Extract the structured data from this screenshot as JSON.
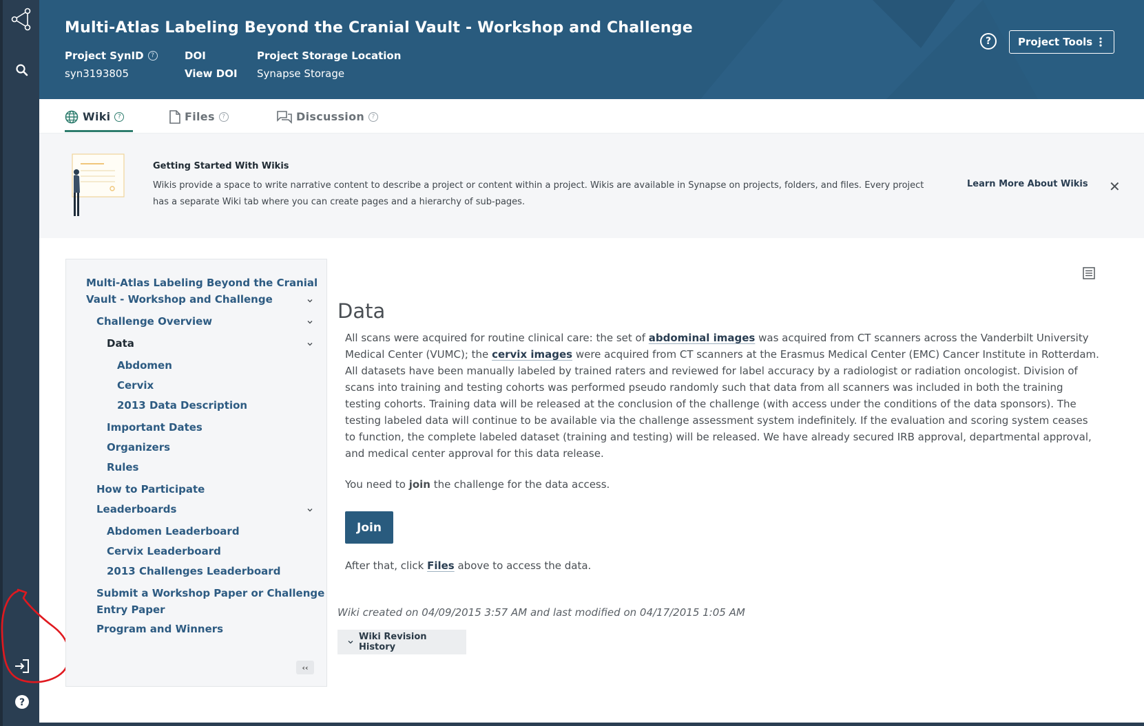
{
  "header": {
    "title": "Multi-Atlas Labeling Beyond the Cranial Vault - Workshop and Challenge",
    "synid_label": "Project SynID",
    "synid_value": "syn3193805",
    "doi_label": "DOI",
    "doi_value": "View DOI",
    "storage_label": "Project Storage Location",
    "storage_value": "Synapse Storage",
    "tools_label": "Project Tools",
    "help_glyph": "?"
  },
  "tabs": [
    {
      "label": "Wiki",
      "icon": "globe-icon"
    },
    {
      "label": "Files",
      "icon": "file-icon"
    },
    {
      "label": "Discussion",
      "icon": "discussion-icon"
    }
  ],
  "banner": {
    "title": "Getting Started With Wikis",
    "text": "Wikis provide a space to write narrative content to describe a project or content within a project. Wikis are available in Synapse on projects, folders, and files. Every project has a separate Wiki tab where you can create pages and a hierarchy of sub-pages.",
    "link": "Learn More About Wikis"
  },
  "nav": {
    "root_line1": "Multi-Atlas Labeling Beyond the Cranial",
    "root_line2": "Vault - Workshop and Challenge",
    "challenge_overview": "Challenge Overview",
    "data": "Data",
    "abdomen": "Abdomen",
    "cervix": "Cervix",
    "desc_2013": "2013 Data Description",
    "important_dates": "Important Dates",
    "organizers": "Organizers",
    "rules": "Rules",
    "how_to": "How to Participate",
    "leaderboards": "Leaderboards",
    "abdomen_lb": "Abdomen Leaderboard",
    "cervix_lb": "Cervix Leaderboard",
    "challenges_lb": "2013 Challenges Leaderboard",
    "submit_line1": "Submit a Workshop Paper or Challenge",
    "submit_line2": "Entry Paper",
    "program": "Program and Winners",
    "collapse": "‹‹"
  },
  "content": {
    "title": "Data",
    "p1_a": "All scans were acquired for routine clinical care: the set of ",
    "p1_link1": "abdominal images",
    "p1_b": " was acquired from CT scanners across the Vanderbilt University Medical Center (VUMC); the ",
    "p1_link2": "cervix images",
    "p1_c": " were acquired from CT scanners at the Erasmus Medical Center (EMC) Cancer Institute in Rotterdam. All datasets have been manually labeled by trained raters and reviewed for label accuracy by a radiologist or radiation oncologist. Division of scans into training and testing cohorts was performed pseudo randomly such that data from all scanners was included in both the training testing cohorts. Training data will be released at the conclusion of the challenge (with access under the conditions of the data sponsors). The testing labeled data will continue to be available via the challenge assessment system indefinitely. If the evaluation and scoring system ceases to function, the complete labeled dataset (training and testing) will be released. We have already secured IRB approval, departmental approval, and medical center approval for this data release.",
    "join_a": "You need to ",
    "join_bold": "join",
    "join_b": " the challenge for the data access.",
    "join_button": "Join",
    "after_a": "After that, click ",
    "after_link": "Files",
    "after_b": " above to access the data.",
    "meta": "Wiki created on 04/09/2015 3:57 AM and last modified on 04/17/2015 1:05 AM",
    "revision": "Wiki Revision History"
  },
  "colors": {
    "rail": "#2a3e52",
    "header": "#295b7e",
    "accent": "#2e7d6e",
    "annotation": "#e0191f"
  }
}
